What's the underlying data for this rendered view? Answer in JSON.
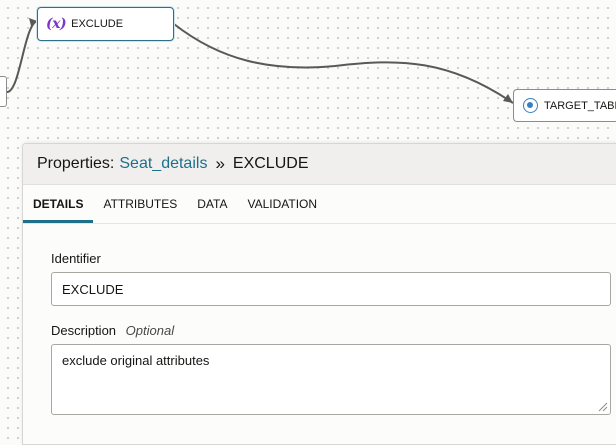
{
  "canvas": {
    "nodes": {
      "exclude": {
        "icon": "fx-expression-icon",
        "fx_glyph": "(x)",
        "label": "EXCLUDE"
      },
      "target": {
        "icon": "target-table-icon",
        "label": "TARGET_TABL"
      }
    }
  },
  "properties": {
    "heading_prefix": "Properties:",
    "object_link": "Seat_details",
    "separator": "»",
    "current": "EXCLUDE",
    "tabs": [
      {
        "label": "DETAILS",
        "active": true
      },
      {
        "label": "ATTRIBUTES",
        "active": false
      },
      {
        "label": "DATA",
        "active": false
      },
      {
        "label": "VALIDATION",
        "active": false
      }
    ],
    "identifier": {
      "label": "Identifier",
      "value": "EXCLUDE"
    },
    "description": {
      "label": "Description",
      "optional": "Optional",
      "value": "exclude original attributes"
    }
  },
  "colors": {
    "accent": "#1f6f8b",
    "expression": "#7b38c8",
    "target": "#3a7fc1"
  }
}
